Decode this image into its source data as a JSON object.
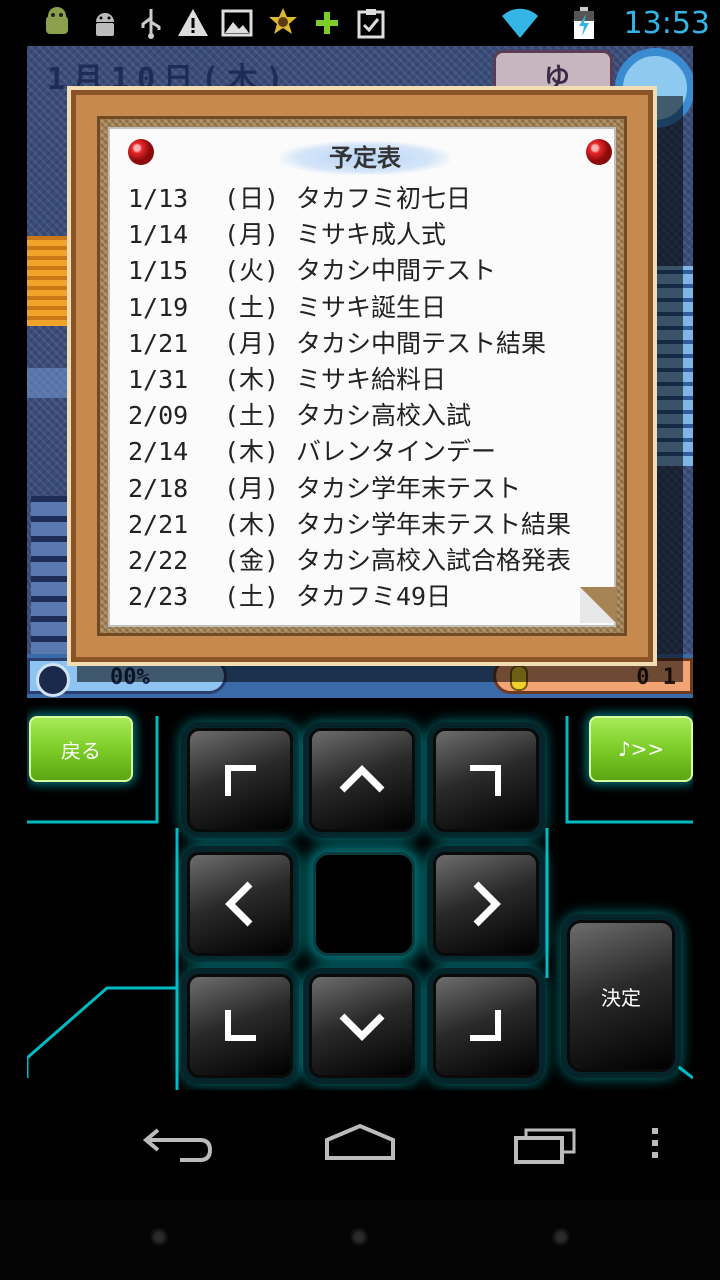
{
  "status_bar": {
    "time": "13:53",
    "left_icons": [
      "android-robot-icon",
      "debug-android-icon",
      "usb-icon",
      "warning-icon",
      "picture-icon",
      "sheriff-badge-icon",
      "plus-icon",
      "clipboard-check-icon"
    ],
    "right_icons": [
      "wifi-icon",
      "battery-charging-icon"
    ]
  },
  "game": {
    "date_label": "1月10日(木)",
    "sign_label": "ゆ",
    "affection_percent": "00%",
    "money": "0 1"
  },
  "schedule_board": {
    "title": "予定表",
    "entries": [
      {
        "date": "1/13",
        "day": "(日)",
        "event": "タカフミ初七日"
      },
      {
        "date": "1/14",
        "day": "(月)",
        "event": "ミサキ成人式"
      },
      {
        "date": "1/15",
        "day": "(火)",
        "event": "タカシ中間テスト"
      },
      {
        "date": "1/19",
        "day": "(土)",
        "event": "ミサキ誕生日"
      },
      {
        "date": "1/21",
        "day": "(月)",
        "event": "タカシ中間テスト結果"
      },
      {
        "date": "1/31",
        "day": "(木)",
        "event": "ミサキ給料日"
      },
      {
        "date": "2/09",
        "day": "(土)",
        "event": "タカシ高校入試"
      },
      {
        "date": "2/14",
        "day": "(木)",
        "event": "バレンタインデー"
      },
      {
        "date": "2/18",
        "day": "(月)",
        "event": "タカシ学年末テスト"
      },
      {
        "date": "2/21",
        "day": "(木)",
        "event": "タカシ学年末テスト結果"
      },
      {
        "date": "2/22",
        "day": "(金)",
        "event": "タカシ高校入試合格発表"
      },
      {
        "date": "2/23",
        "day": "(土)",
        "event": "タカフミ49日"
      }
    ]
  },
  "controls": {
    "back_label": "戻る",
    "music_label": "♪>>",
    "decide_label": "決定",
    "dpad": [
      "up-left",
      "up",
      "up-right",
      "left",
      "center",
      "right",
      "down-left",
      "down",
      "down-right"
    ],
    "accent_color": "#00dce6",
    "green_color": "#7ccd28"
  },
  "nav_bar": {
    "buttons": [
      "back-icon",
      "home-icon",
      "recent-apps-icon",
      "overflow-menu-icon"
    ]
  }
}
